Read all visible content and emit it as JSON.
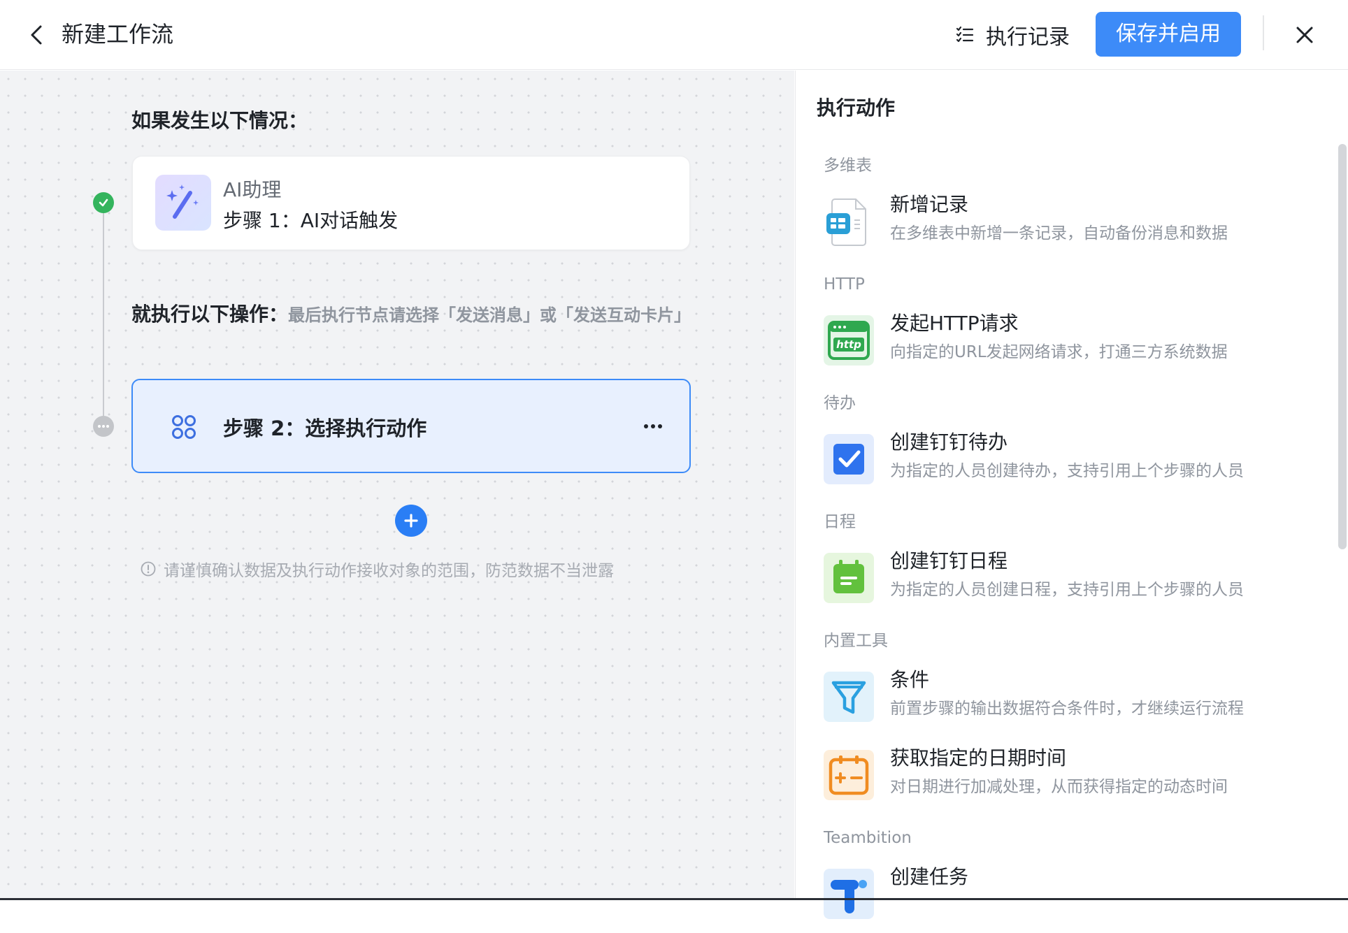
{
  "header": {
    "title": "新建工作流",
    "history_label": "执行记录",
    "save_label": "保存并启用"
  },
  "canvas": {
    "condition_title": "如果发生以下情况：",
    "trigger": {
      "sub_label": "AI助理",
      "step_label": "步骤 1：AI对话触发"
    },
    "action_title": "就执行以下操作：",
    "action_hint": "最后执行节点请选择「发送消息」或「发送互动卡片」",
    "action_step": {
      "label": "步骤 2：选择执行动作"
    },
    "notice": "请谨慎确认数据及执行动作接收对象的范围，防范数据不当泄露"
  },
  "panel": {
    "title": "执行动作",
    "sections": [
      {
        "label": "多维表",
        "items": [
          {
            "title": "新增记录",
            "desc": "在多维表中新增一条记录，自动备份消息和数据",
            "icon": "table-doc-icon"
          }
        ]
      },
      {
        "label": "HTTP",
        "items": [
          {
            "title": "发起HTTP请求",
            "desc": "向指定的URL发起网络请求，打通三方系统数据",
            "icon": "http-icon"
          }
        ]
      },
      {
        "label": "待办",
        "items": [
          {
            "title": "创建钉钉待办",
            "desc": "为指定的人员创建待办，支持引用上个步骤的人员",
            "icon": "todo-check-icon"
          }
        ]
      },
      {
        "label": "日程",
        "items": [
          {
            "title": "创建钉钉日程",
            "desc": "为指定的人员创建日程，支持引用上个步骤的人员",
            "icon": "calendar-icon"
          }
        ]
      },
      {
        "label": "内置工具",
        "items": [
          {
            "title": "条件",
            "desc": "前置步骤的输出数据符合条件时，才继续运行流程",
            "icon": "filter-icon"
          },
          {
            "title": "获取指定的日期时间",
            "desc": "对日期进行加减处理，从而获得指定的动态时间",
            "icon": "date-calc-icon"
          }
        ]
      },
      {
        "label": "Teambition",
        "items": [
          {
            "title": "创建任务",
            "desc": "",
            "icon": "teambition-icon"
          }
        ]
      }
    ]
  },
  "colors": {
    "accent": "#3d8bf8",
    "success": "#34b45d",
    "canvas_bg": "#f2f3f5"
  }
}
